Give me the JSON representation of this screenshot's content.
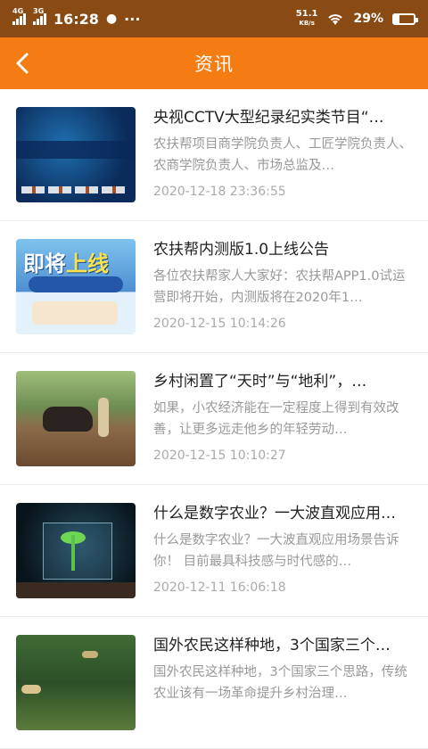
{
  "status_bar": {
    "net1": "4G",
    "net2": "3G",
    "time": "16:28",
    "more": "···",
    "speed_value": "51.1",
    "speed_unit": "KB/s",
    "battery": "29%",
    "battery_level": 0.29
  },
  "header": {
    "title": "资讯",
    "back_icon": "chevron-left-icon"
  },
  "articles": [
    {
      "title": "央视CCTV大型纪录纪实类节目“…",
      "summary": "农扶帮项目商学院负责人、工匠学院负责人、农商学院负责人、市场总监及…",
      "date": "2020-12-18 23:36:55",
      "thumb_text": ""
    },
    {
      "title": "农扶帮内测版1.0上线公告",
      "summary": "各位农扶帮家人大家好：农扶帮APP1.0试运营即将开始，内测版将在2020年1…",
      "date": "2020-12-15 10:14:26",
      "thumb_text": "即将上线"
    },
    {
      "title": "乡村闲置了“天时”与“地利”，…",
      "summary": "如果，小农经济能在一定程度上得到有效改善，让更多远走他乡的年轻劳动…",
      "date": "2020-12-15 10:10:27",
      "thumb_text": ""
    },
    {
      "title": "什么是数字农业？一大波直观应用…",
      "summary": "什么是数字农业？一大波直观应用场景告诉你！ 目前最具科技感与时代感的…",
      "date": "2020-12-11 16:06:18",
      "thumb_text": ""
    },
    {
      "title": "国外农民这样种地，3个国家三个…",
      "summary": "国外农民这样种地，3个国家三个思路，传统农业该有一场革命提升乡村治理…",
      "date": "",
      "thumb_text": ""
    }
  ]
}
